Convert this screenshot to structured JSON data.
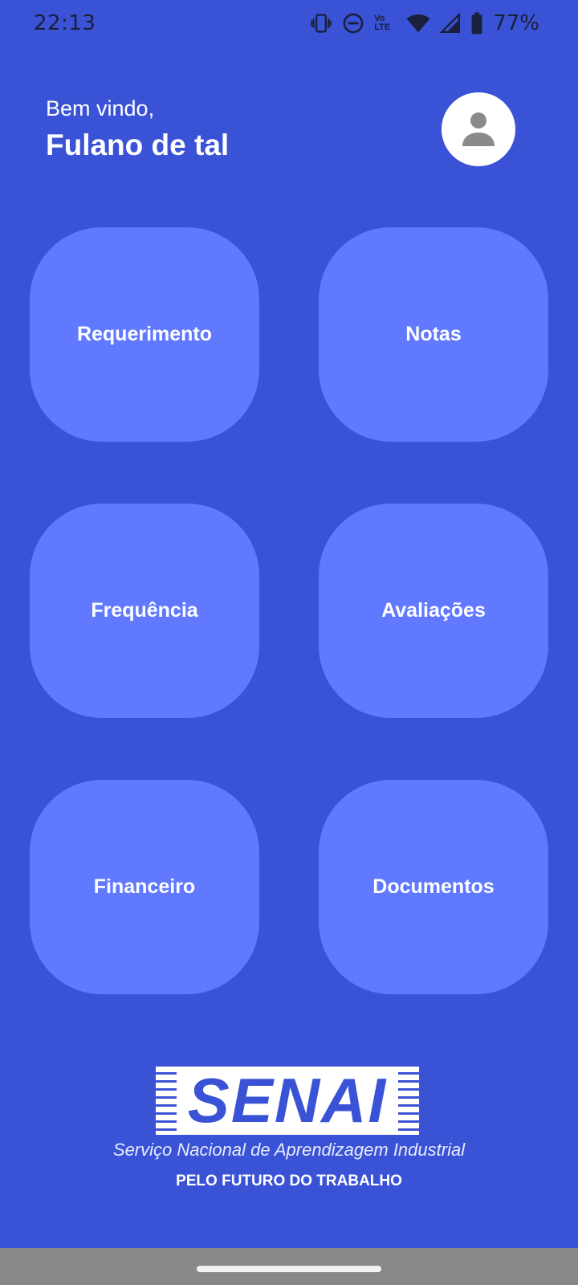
{
  "status_bar": {
    "time": "22:13",
    "volte_label": "Vo LTE",
    "battery_percent": "77%",
    "icons": [
      "vibrate-icon",
      "do-not-disturb-icon",
      "volte-icon",
      "wifi-icon",
      "signal-icon",
      "battery-icon"
    ]
  },
  "header": {
    "greeting": "Bem vindo,",
    "username": "Fulano de tal",
    "avatar_icon": "person-icon"
  },
  "menu": {
    "items": [
      {
        "label": "Requerimento"
      },
      {
        "label": "Notas"
      },
      {
        "label": "Frequência"
      },
      {
        "label": "Avaliações"
      },
      {
        "label": "Financeiro"
      },
      {
        "label": "Documentos"
      }
    ]
  },
  "logo": {
    "wordmark": "SENAI",
    "subtitle": "Serviço Nacional de Aprendizagem Industrial",
    "motto": "PELO FUTURO DO TRABALHO"
  },
  "colors": {
    "background": "#3a53d6",
    "tile": "#6079ff",
    "status_text": "#1a1f3a",
    "nav_bar": "#888888"
  }
}
